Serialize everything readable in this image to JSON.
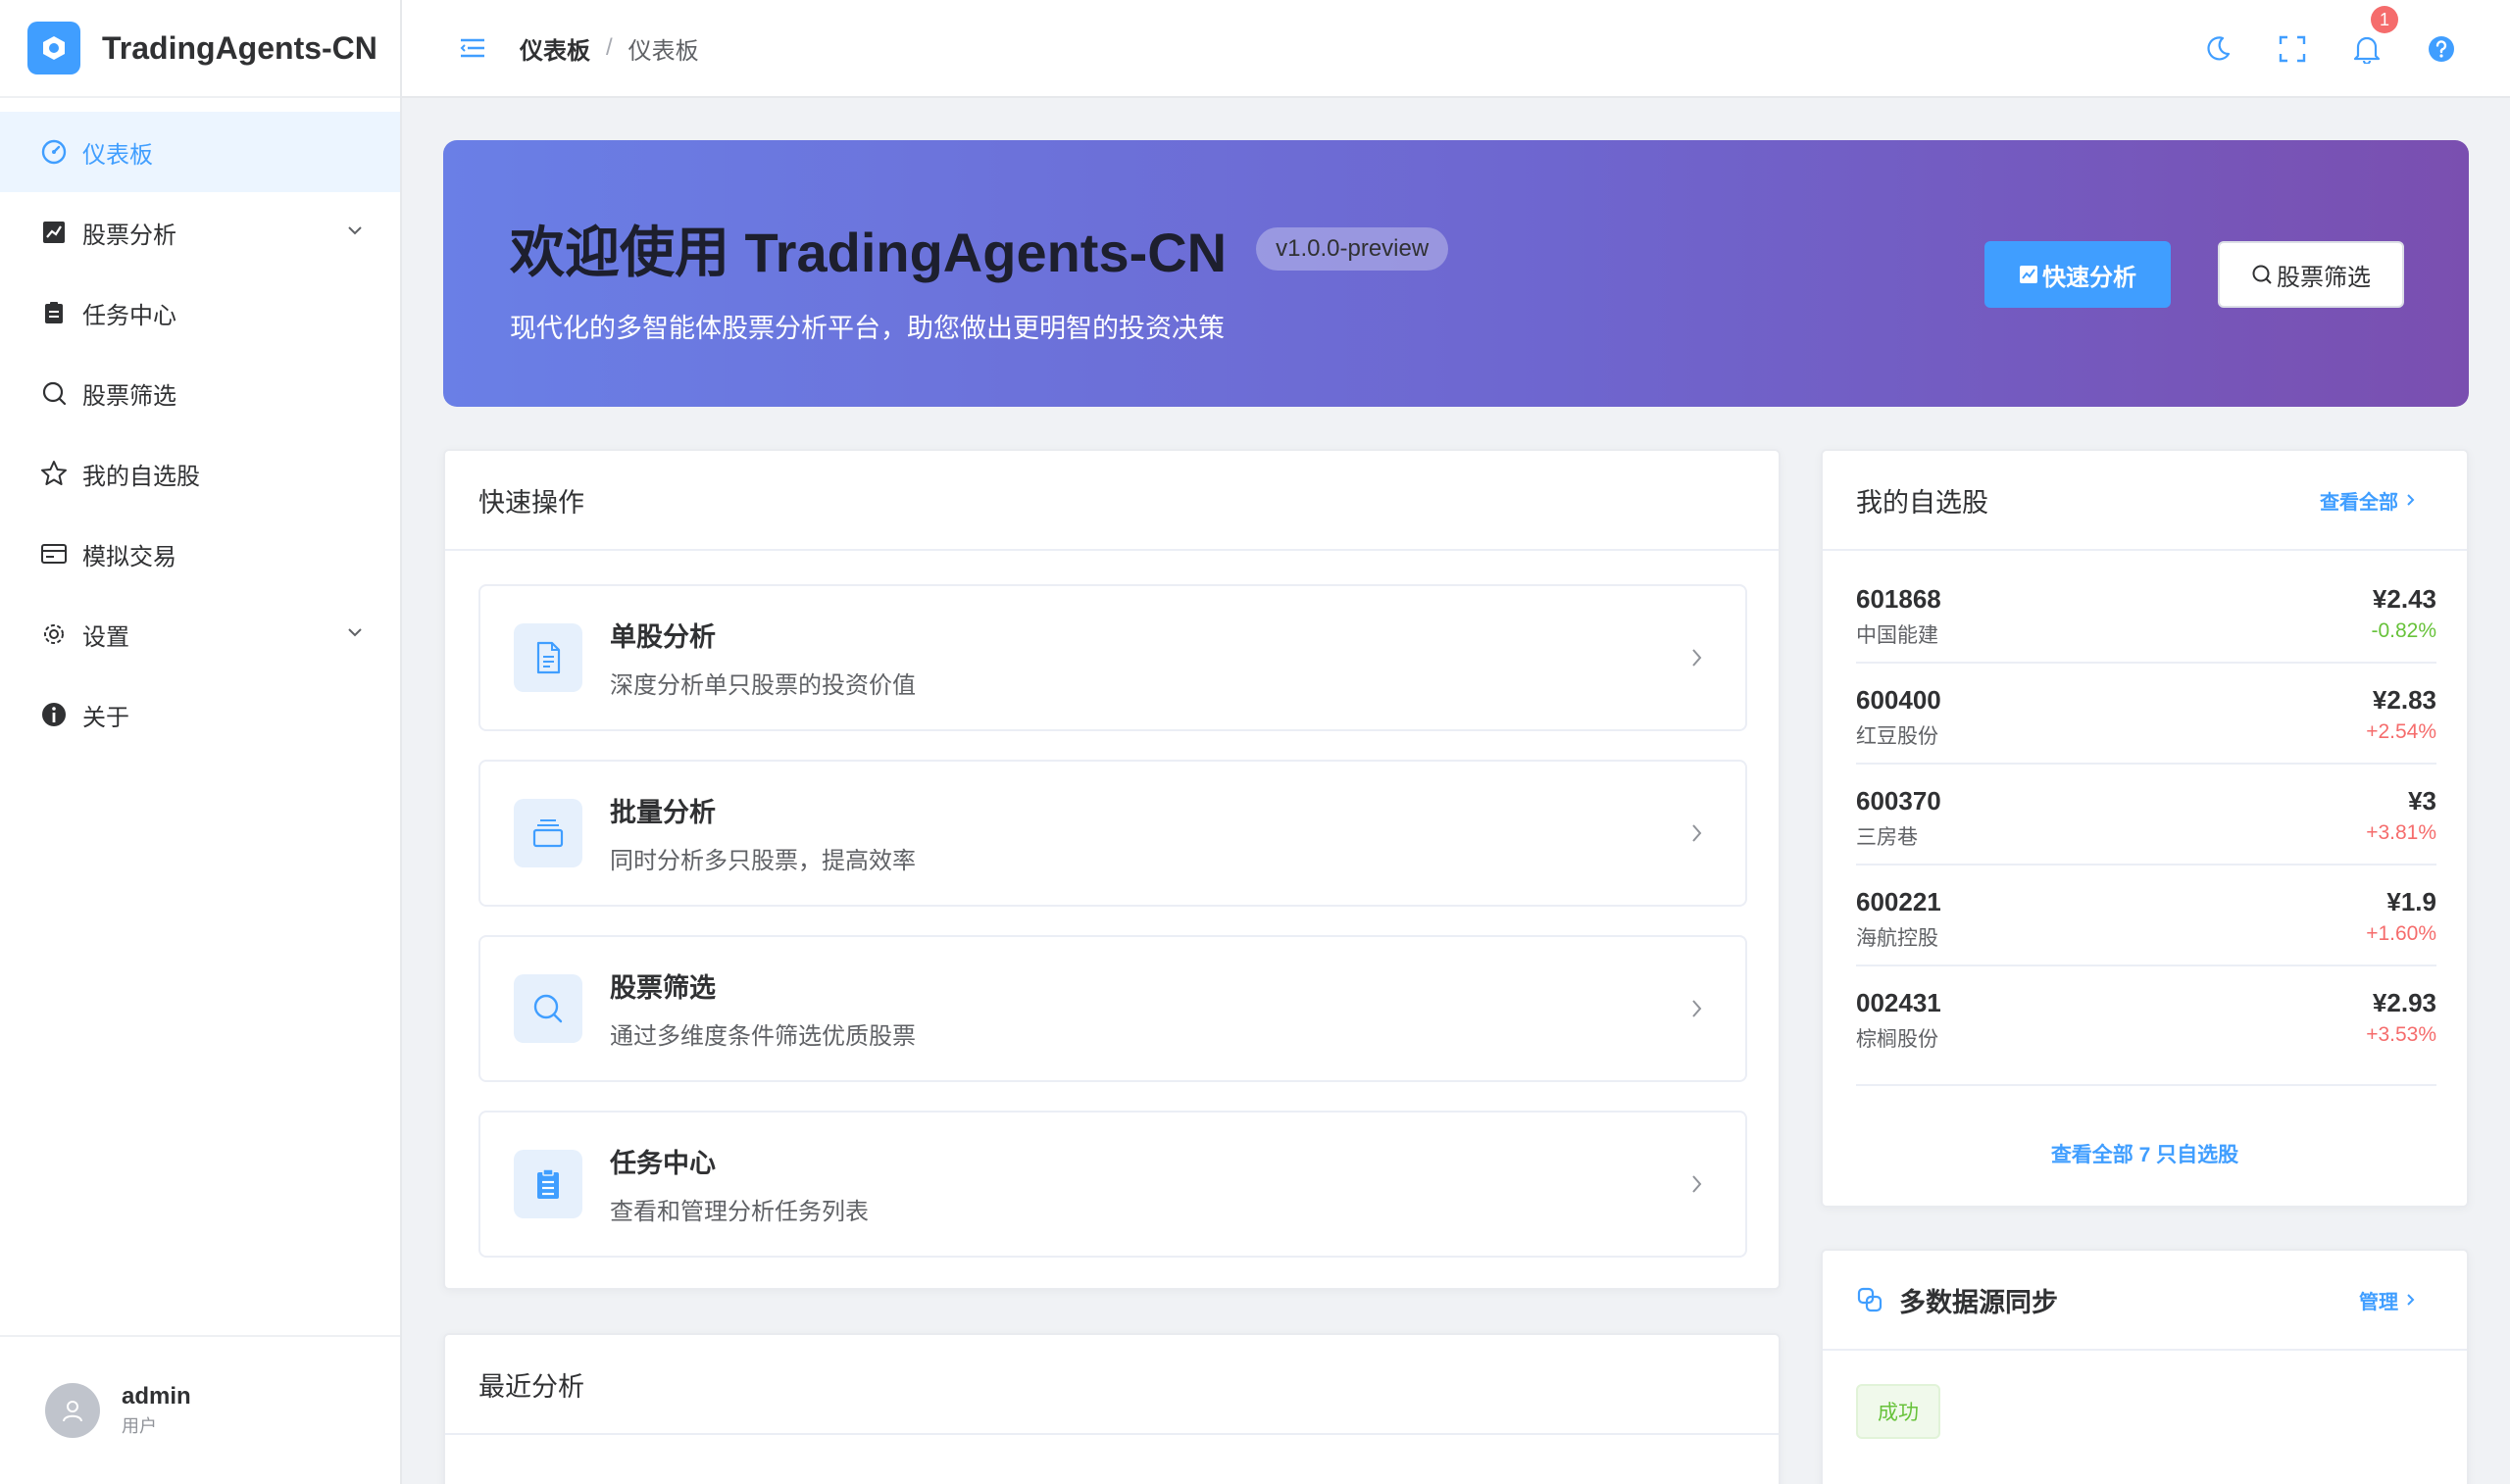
{
  "brand": {
    "title": "TradingAgents-CN"
  },
  "sidebar": {
    "items": [
      {
        "label": "仪表板",
        "icon": "dashboard-icon"
      },
      {
        "label": "股票分析",
        "icon": "chart-icon",
        "expandable": true
      },
      {
        "label": "任务中心",
        "icon": "clipboard-icon"
      },
      {
        "label": "股票筛选",
        "icon": "search-icon"
      },
      {
        "label": "我的自选股",
        "icon": "star-icon"
      },
      {
        "label": "模拟交易",
        "icon": "card-icon"
      },
      {
        "label": "设置",
        "icon": "gear-icon",
        "expandable": true
      },
      {
        "label": "关于",
        "icon": "info-icon"
      }
    ]
  },
  "user": {
    "name": "admin",
    "role": "用户"
  },
  "header": {
    "breadcrumb": [
      "仪表板",
      "仪表板"
    ],
    "notifications": "1"
  },
  "banner": {
    "title": "欢迎使用 TradingAgents-CN",
    "version": "v1.0.0-preview",
    "subtitle": "现代化的多智能体股票分析平台，助您做出更明智的投资决策",
    "primary_label": "快速分析",
    "secondary_label": "股票筛选"
  },
  "quick": {
    "title": "快速操作",
    "actions": [
      {
        "title": "单股分析",
        "desc": "深度分析单只股票的投资价值",
        "icon": "document-icon"
      },
      {
        "title": "批量分析",
        "desc": "同时分析多只股票，提高效率",
        "icon": "stack-icon"
      },
      {
        "title": "股票筛选",
        "desc": "通过多维度条件筛选优质股票",
        "icon": "search-icon"
      },
      {
        "title": "任务中心",
        "desc": "查看和管理分析任务列表",
        "icon": "clipboard-icon"
      }
    ]
  },
  "recent": {
    "title": "最近分析"
  },
  "watchlist": {
    "title": "我的自选股",
    "view_all": "查看全部",
    "view_all_footer": "查看全部 7 只自选股",
    "stocks": [
      {
        "code": "601868",
        "name": "中国能建",
        "price": "¥2.43",
        "change": "-0.82%"
      },
      {
        "code": "600400",
        "name": "红豆股份",
        "price": "¥2.83",
        "change": "+2.54%"
      },
      {
        "code": "600370",
        "name": "三房巷",
        "price": "¥3",
        "change": "+3.81%"
      },
      {
        "code": "600221",
        "name": "海航控股",
        "price": "¥1.9",
        "change": "+1.60%"
      },
      {
        "code": "002431",
        "name": "棕榈股份",
        "price": "¥2.93",
        "change": "+3.53%"
      }
    ]
  },
  "sync": {
    "title": "多数据源同步",
    "manage": "管理",
    "status": "成功"
  },
  "colors": {
    "accent": "#409eff",
    "up": "#f56c6c",
    "down": "#67c23a"
  }
}
